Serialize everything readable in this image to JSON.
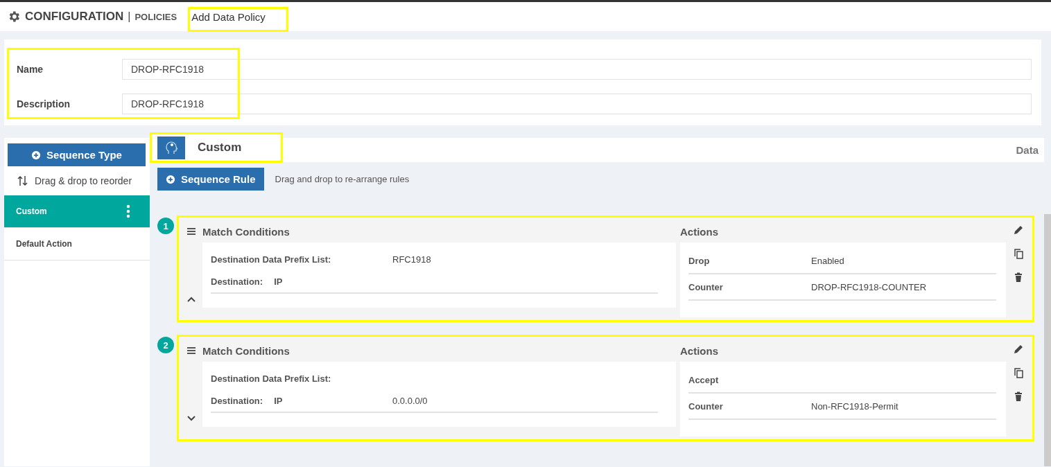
{
  "header": {
    "title": "CONFIGURATION",
    "separator": "|",
    "section": "POLICIES",
    "subtitle": "Add Data Policy"
  },
  "form": {
    "fields": [
      {
        "label": "Name",
        "value": "DROP-RFC1918"
      },
      {
        "label": "Description",
        "value": "DROP-RFC1918"
      }
    ]
  },
  "sidebar": {
    "button": "Sequence Type",
    "hint": "Drag & drop to reorder",
    "items": [
      {
        "label": "Custom",
        "selected": true
      },
      {
        "label": "Default Action",
        "selected": false
      }
    ]
  },
  "main": {
    "title": "Custom",
    "right_label": "Data",
    "rule_button": "Sequence Rule",
    "rule_hint": "Drag and drop to re-arrange rules",
    "rules": [
      {
        "number": "1",
        "expanded": true,
        "match_title": "Match Conditions",
        "actions_title": "Actions",
        "conditions": [
          {
            "label": "Destination Data Prefix List:",
            "value": "RFC1918"
          },
          {
            "label": "Destination:",
            "field": "IP"
          }
        ],
        "actions": [
          {
            "label": "Drop",
            "value": "Enabled"
          },
          {
            "label": "Counter",
            "value": "DROP-RFC1918-COUNTER"
          }
        ]
      },
      {
        "number": "2",
        "expanded": false,
        "match_title": "Match Conditions",
        "actions_title": "Actions",
        "conditions": [
          {
            "label": "Destination Data Prefix List:"
          },
          {
            "label": "Destination:",
            "field": "IP",
            "value": "0.0.0.0/0"
          }
        ],
        "actions": [
          {
            "label": "Accept"
          },
          {
            "label": "Counter",
            "value": "Non-RFC1918-Permit"
          }
        ]
      }
    ]
  }
}
